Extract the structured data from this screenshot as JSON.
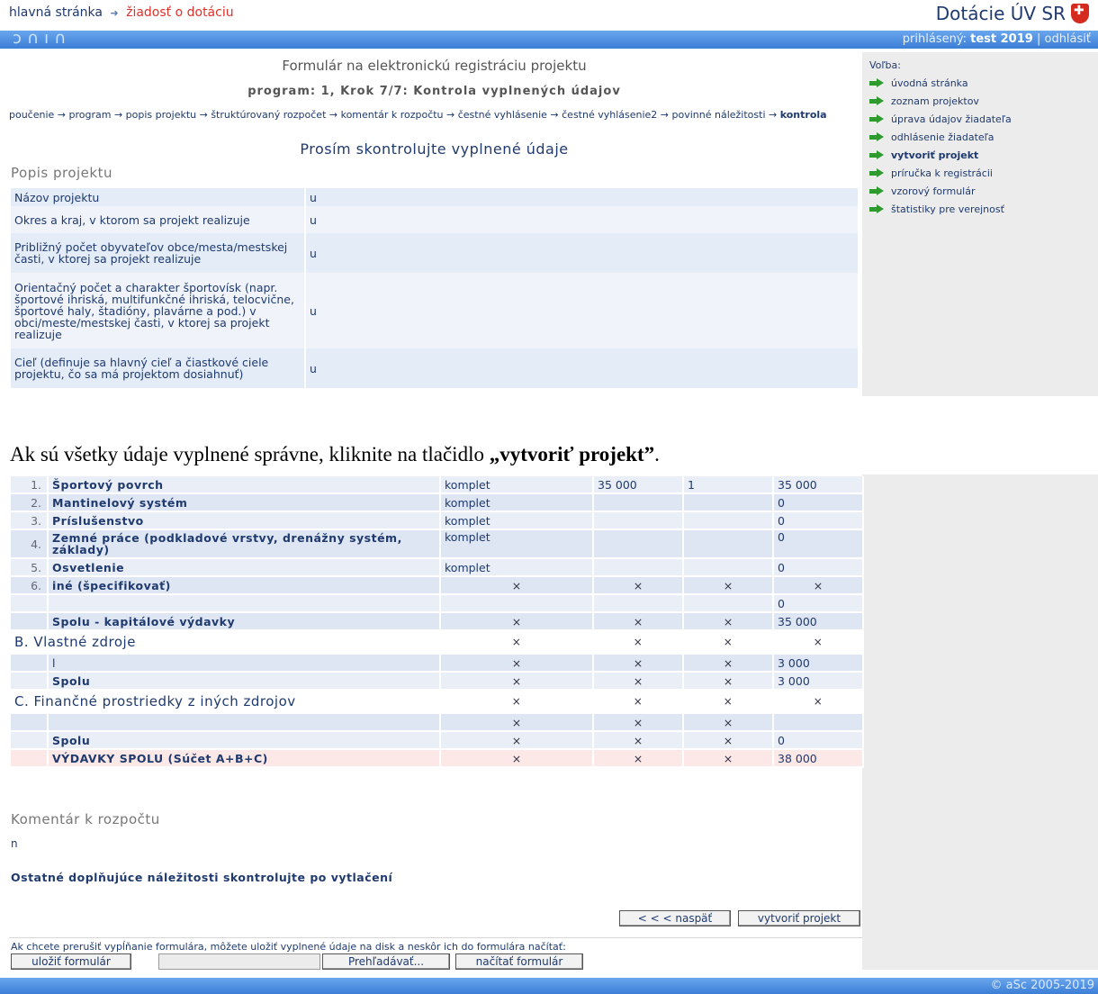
{
  "header": {
    "breadcrumb_home": "hlavná stránka",
    "breadcrumb_sep": "➜",
    "breadcrumb_current": "žiadosť o dotáciu",
    "brand": "Dotácie ÚV SR",
    "logo_text": "ↄ∩ı∩",
    "logged_label": "prihlásený:",
    "logged_user": "test 2019",
    "divider": "|",
    "logout": "odhlásiť"
  },
  "form": {
    "title": "Formulár na elektronickú registráciu projektu",
    "step": "program: 1, Krok 7/7: Kontrola vyplnených údajov",
    "steps_text": "poučenie → program → popis projektu → štruktúrovaný rozpočet → komentár k rozpočtu → čestné vyhlásenie → čestné vyhlásenie2 → povinné náležitosti →",
    "steps_current": "kontrola",
    "check_title": "Prosím skontrolujte vyplnené údaje",
    "section": "Popis projektu",
    "rows": [
      {
        "label": "Názov projektu",
        "value": "u"
      },
      {
        "label": "Okres a kraj, v ktorom sa projekt realizuje",
        "value": "u"
      },
      {
        "label": "Približný počet obyvateľov obce/mesta/mestskej časti, v ktorej sa projekt realizuje",
        "value": "u"
      },
      {
        "label": "Orientačný počet a charakter športovísk (napr. športové ihriská, multifunkčné ihriská, telocvične, športové haly, štadióny, plavárne a pod.) v obci/meste/mestskej časti, v ktorej sa projekt realizuje",
        "value": "u"
      },
      {
        "label": "Cieľ (definuje sa hlavný cieľ a čiastkové ciele projektu, čo sa má projektom dosiahnuť)",
        "value": "u"
      }
    ]
  },
  "sidebar": {
    "label": "Voľba:",
    "items": [
      {
        "label": "úvodná stránka"
      },
      {
        "label": "zoznam projektov"
      },
      {
        "label": "úprava údajov žiadateľa"
      },
      {
        "label": "odhlásenie žiadateľa"
      },
      {
        "label": "vytvoriť projekt"
      },
      {
        "label": "príručka k registrácii"
      },
      {
        "label": "vzorový formulár"
      },
      {
        "label": "štatistiky pre verejnosť"
      }
    ]
  },
  "caption": {
    "text": "Ak sú všetky údaje vyplnené správne, kliknite na tlačidlo ",
    "bold": "„vytvoriť projekt”",
    "end": "."
  },
  "budget": {
    "rows": [
      {
        "n": "1.",
        "name": "Športový povrch",
        "unit": "komplet",
        "price": "35 000",
        "qty": "1",
        "total": "35 000"
      },
      {
        "n": "2.",
        "name": "Mantinelový systém",
        "unit": "komplet",
        "price": "",
        "qty": "",
        "total": "0"
      },
      {
        "n": "3.",
        "name": "Príslušenstvo",
        "unit": "komplet",
        "price": "",
        "qty": "",
        "total": "0"
      },
      {
        "n": "4.",
        "name": "Zemné práce (podkladové vrstvy, drenážny systém, základy)",
        "unit": "komplet",
        "price": "",
        "qty": "",
        "total": "0"
      },
      {
        "n": "5.",
        "name": "Osvetlenie",
        "unit": "komplet",
        "price": "",
        "qty": "",
        "total": "0"
      },
      {
        "n": "6.",
        "name": "iné (špecifikovať)",
        "unit": "×",
        "price": "×",
        "qty": "×",
        "total": "×"
      },
      {
        "n": "",
        "name": "",
        "unit": "",
        "price": "",
        "qty": "",
        "total": "0"
      },
      {
        "n": "",
        "name": "Spolu - kapitálové výdavky",
        "unit": "×",
        "price": "×",
        "qty": "×",
        "total": "35 000"
      }
    ],
    "b_head": {
      "title": "B. Vlastné zdroje",
      "unit": "×",
      "price": "×",
      "qty": "×",
      "total": "×"
    },
    "b_rows": [
      {
        "name": "l",
        "unit": "×",
        "price": "×",
        "qty": "×",
        "total": "3 000"
      },
      {
        "name": "Spolu",
        "unit": "×",
        "price": "×",
        "qty": "×",
        "total": "3 000"
      }
    ],
    "c_head": {
      "title": "C. Finančné prostriedky z iných zdrojov",
      "unit": "×",
      "price": "×",
      "qty": "×",
      "total": "×"
    },
    "c_rows": [
      {
        "name": "",
        "unit": "×",
        "price": "×",
        "qty": "×",
        "total": ""
      },
      {
        "name": "Spolu",
        "unit": "×",
        "price": "×",
        "qty": "×",
        "total": "0"
      }
    ],
    "grand": {
      "name": "VÝDAVKY SPOLU (Súčet A+B+C)",
      "unit": "×",
      "price": "×",
      "qty": "×",
      "total": "38 000"
    }
  },
  "comment": {
    "heading": "Komentár k rozpočtu",
    "value": "n",
    "note": "Ostatné doplňujúce náležitosti skontrolujte po vytlačení"
  },
  "buttons": {
    "back": "< < <  naspäť",
    "create": "vytvoriť projekt",
    "save_note": "Ak chcete prerušiť vypĺňanie formulára, môžete uložiť vyplnené údaje na disk a neskôr ich do formulára načítať:",
    "save": "uložiť formulár",
    "browse": "Prehľadávať...",
    "load": "načítať formulár"
  },
  "footer": {
    "copyright": "© aSc 2005-2019"
  }
}
